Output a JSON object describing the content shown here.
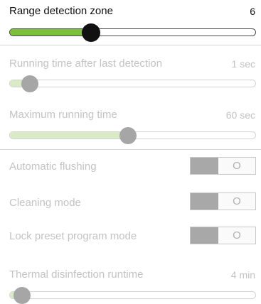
{
  "range_detection": {
    "label": "Range detection zone",
    "value": "6",
    "level": 0.33
  },
  "running_time": {
    "label": "Running time after last detection",
    "value": "1 sec",
    "level": 0.08
  },
  "max_running_time": {
    "label": "Maximum running time",
    "value": "60 sec",
    "level": 0.48
  },
  "automatic_flushing": {
    "label": "Automatic flushing",
    "state": "O"
  },
  "cleaning_mode": {
    "label": "Cleaning mode",
    "state": "O"
  },
  "lock_preset": {
    "label": "Lock preset program mode",
    "state": "O"
  },
  "thermal_disinfection": {
    "label": "Thermal disinfection runtime",
    "value": "4 min",
    "level": 0.05
  },
  "colors": {
    "accent": "#7bbf3a",
    "accent_disabled": "#d9ebc4",
    "thumb_active": "#111111",
    "thumb_disabled": "#a6a6a6",
    "disabled_text": "#c3c3c3"
  }
}
